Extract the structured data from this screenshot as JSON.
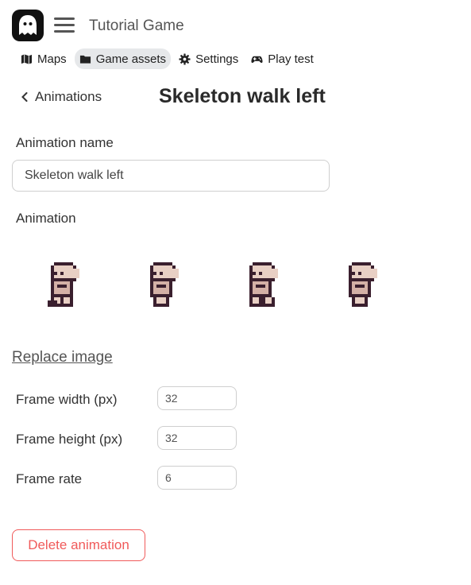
{
  "app": {
    "title": "Tutorial Game",
    "logo_icon": "ghost-icon"
  },
  "nav": {
    "tabs": [
      {
        "label": "Maps",
        "icon": "map-icon"
      },
      {
        "label": "Game assets",
        "icon": "folder-icon",
        "active": true
      },
      {
        "label": "Settings",
        "icon": "gear-icon"
      },
      {
        "label": "Play test",
        "icon": "gamepad-icon"
      }
    ]
  },
  "breadcrumb": {
    "back_label": "Animations"
  },
  "page": {
    "title": "Skeleton walk left"
  },
  "form": {
    "name_label": "Animation name",
    "name_value": "Skeleton walk left",
    "animation_label": "Animation",
    "frames": [
      "frame-1",
      "frame-2",
      "frame-3",
      "frame-4"
    ],
    "replace_image_label": "Replace image",
    "frame_width_label": "Frame width (px)",
    "frame_width_value": "32",
    "frame_height_label": "Frame height (px)",
    "frame_height_value": "32",
    "frame_rate_label": "Frame rate",
    "frame_rate_value": "6",
    "delete_label": "Delete animation"
  },
  "colors": {
    "accent_danger": "#f05a5a",
    "tab_active_bg": "#e6e8ea",
    "sprite_dark": "#3a1f2e",
    "sprite_light": "#e8cfc4"
  }
}
